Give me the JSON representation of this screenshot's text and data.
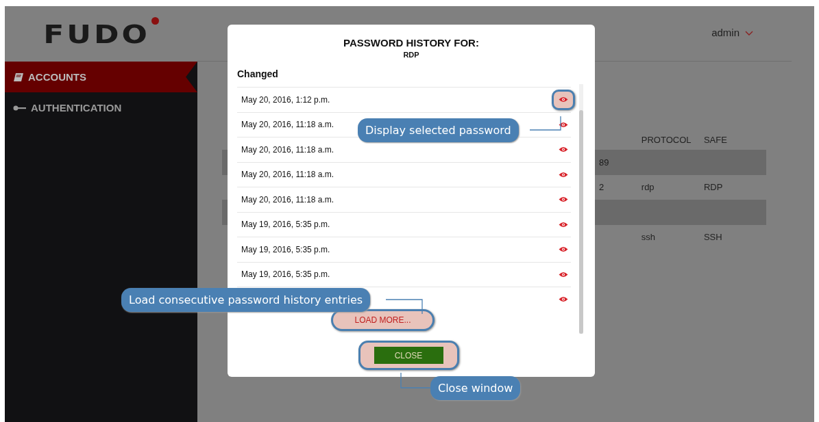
{
  "logo": {
    "text": "FUDO"
  },
  "user_menu": {
    "label": "admin"
  },
  "sidebar": {
    "items": [
      {
        "label": "ACCOUNTS",
        "selected": true,
        "kind": "book"
      },
      {
        "label": "AUTHENTICATION",
        "selected": false,
        "kind": "key"
      }
    ]
  },
  "table": {
    "columns": [
      {
        "label": "PROTOCOL"
      },
      {
        "label": "SAFE"
      }
    ],
    "rows": [
      {
        "kind": "group",
        "column_1": "89"
      },
      {
        "kind": "item",
        "column_1": "2",
        "protocol": "rdp",
        "safe": "RDP"
      },
      {
        "kind": "group"
      },
      {
        "kind": "item",
        "protocol": "ssh",
        "safe": "SSH"
      }
    ]
  },
  "dialog": {
    "title": "PASSWORD HISTORY FOR:",
    "subtitle": "RDP",
    "column_header": "Changed",
    "entries": [
      {
        "date": "May 20, 2016, 1:12 p.m.",
        "highlighted": true
      },
      {
        "date": "May 20, 2016, 11:18 a.m.",
        "highlighted": false
      },
      {
        "date": "May 20, 2016, 11:18 a.m.",
        "highlighted": false
      },
      {
        "date": "May 20, 2016, 11:18 a.m.",
        "highlighted": false
      },
      {
        "date": "May 20, 2016, 11:18 a.m.",
        "highlighted": false
      },
      {
        "date": "May 19, 2016, 5:35 p.m.",
        "highlighted": false
      },
      {
        "date": "May 19, 2016, 5:35 p.m.",
        "highlighted": false
      },
      {
        "date": "May 19, 2016, 5:35 p.m.",
        "highlighted": false
      },
      {
        "highlighted": false
      }
    ],
    "load_more": {
      "label": "LOAD MORE...",
      "highlighted": true
    },
    "close": {
      "label": "CLOSE",
      "highlighted": true
    }
  },
  "callouts": [
    {
      "kind": "view",
      "text": "Display selected password"
    },
    {
      "kind": "load_more",
      "text": "Load consecutive password history entries"
    },
    {
      "kind": "close",
      "text": "Close window"
    }
  ]
}
